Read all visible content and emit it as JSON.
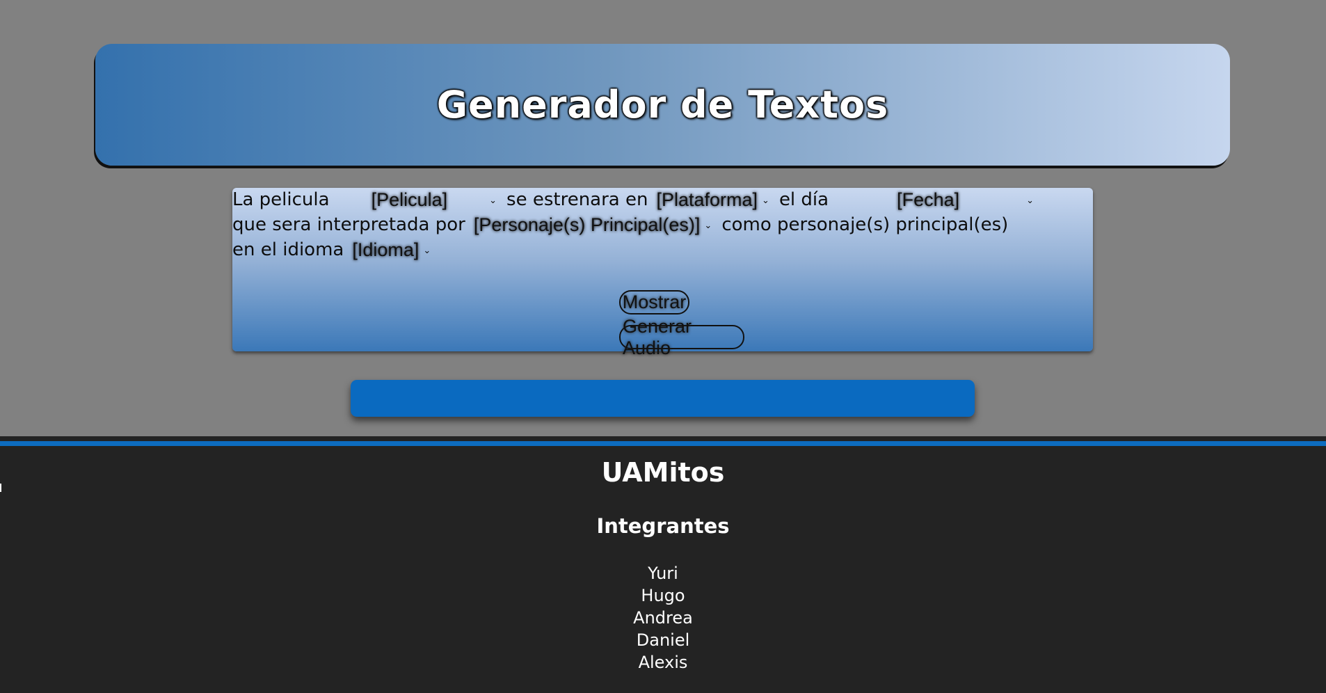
{
  "header": {
    "title": "Generador de Textos"
  },
  "form": {
    "line1": {
      "text_a": "La pelicula",
      "pelicula_select": "[Pelicula]",
      "text_b": "se estrenara en",
      "plataforma_select": "[Plataforma]",
      "text_c": "el día",
      "fecha_select": "[Fecha]"
    },
    "line2": {
      "text_a": "que sera interpretada por",
      "personaje_select": "[Personaje(s) Principal(es)]",
      "text_b": "como personaje(s) principal(es)"
    },
    "line3": {
      "text_a": "en el idioma",
      "idioma_select": "[Idioma]"
    },
    "buttons": {
      "mostrar": "Mostrar",
      "generar_audio": "Generar Audio"
    },
    "chevron_icon": "chevron-down-icon"
  },
  "output": {
    "text": ""
  },
  "footer": {
    "title": "UAMitos",
    "team_heading": "Integrantes",
    "members": [
      "Yuri",
      "Hugo",
      "Andrea",
      "Daniel",
      "Alexis"
    ]
  },
  "colors": {
    "page_bg": "#818181",
    "header_gradient_start": "#3471ad",
    "header_gradient_end": "#c6d6ee",
    "output_bar": "#0a6ac0",
    "footer_bg": "#232323",
    "footer_accent": "#0d6cbf"
  }
}
